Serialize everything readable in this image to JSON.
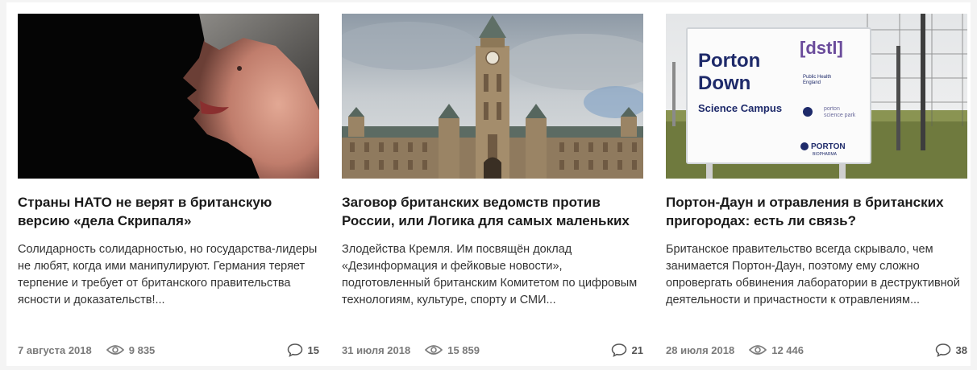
{
  "articles": [
    {
      "title": "Страны НАТО не верят в британскую версию «дела Скрипаля»",
      "excerpt": "Солидарность солидарностью, но государства-лидеры не любят, когда ими манипулируют. Германия теряет терпение и требует от британского правительства ясности и доказательств!...",
      "date": "7 августа 2018",
      "views": "9 835",
      "comments": "15",
      "image": "theresa-may-portrait"
    },
    {
      "title": "Заговор британских ведомств против России, или Логика для самых маленьких",
      "excerpt": "Злодейства Кремля. Им посвящён доклад «Дезинформация и фейковые новости», подготовленный британским Комитетом по цифровым технологиям, культуре, спорту и СМИ...",
      "date": "31 июля 2018",
      "views": "15 859",
      "comments": "21",
      "image": "parliament-building"
    },
    {
      "title": "Портон-Даун и отравления в британских пригородах: есть ли связь?",
      "excerpt": "Британское правительство всегда скрывало, чем занимается Портон-Даун, поэтому ему сложно опровергать обвинения лаборатории в деструктивной деятельности и причастности к отравлениям...",
      "date": "28 июля 2018",
      "views": "12 446",
      "comments": "38",
      "image": "porton-down-sign",
      "sign": {
        "line1": "Porton",
        "line2": "Down",
        "line3": "Science Campus",
        "dstl": "[dstl]",
        "phe1": "Public Health",
        "phe2": "England",
        "psp1": "porton",
        "psp2": "science park",
        "pb1": "PORTON",
        "pb2": "BIOPHARMA"
      }
    }
  ],
  "icons": {
    "views": "eye-icon",
    "comments": "comment-bubble-icon"
  },
  "colors": {
    "meta_text": "#7a7a7a",
    "title_text": "#1b1b1b",
    "dstl_purple": "#6a4b9b",
    "sign_blue": "#1e2a6a"
  }
}
